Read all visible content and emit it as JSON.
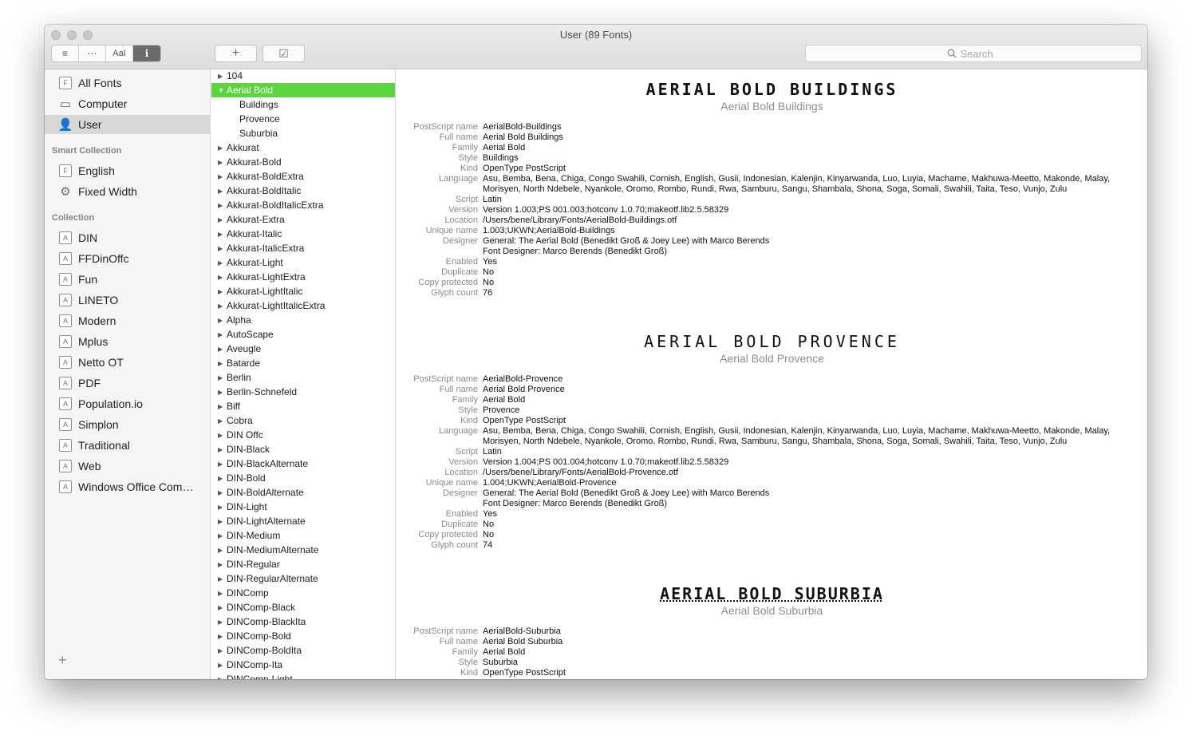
{
  "window": {
    "title": "User (89 Fonts)"
  },
  "toolbar": {
    "view_buttons": [
      "≡",
      "⋯",
      "AaI",
      "i"
    ],
    "add_label": "+",
    "validate_label": "☑",
    "search_placeholder": "Search"
  },
  "sidebar": {
    "libraries": [
      {
        "icon": "font-book-icon",
        "label": "All Fonts"
      },
      {
        "icon": "computer-icon",
        "label": "Computer"
      },
      {
        "icon": "user-icon",
        "label": "User"
      }
    ],
    "smart_heading": "Smart Collection",
    "smart": [
      {
        "icon": "font-book-icon",
        "label": "English"
      },
      {
        "icon": "gear-icon",
        "label": "Fixed Width"
      }
    ],
    "collection_heading": "Collection",
    "collections": [
      "DIN",
      "FFDinOffc",
      "Fun",
      "LINETO",
      "Modern",
      "Mplus",
      "Netto OT",
      "PDF",
      "Population.io",
      "Simplon",
      "Traditional",
      "Web",
      "Windows Office Comp…"
    ],
    "add_label": "+"
  },
  "fontlist": {
    "rows": [
      {
        "label": "104",
        "type": "collapsed"
      },
      {
        "label": "Aerial Bold",
        "type": "expanded"
      },
      {
        "label": "Buildings",
        "type": "child"
      },
      {
        "label": "Provence",
        "type": "child"
      },
      {
        "label": "Suburbia",
        "type": "child"
      },
      {
        "label": "Akkurat",
        "type": "collapsed"
      },
      {
        "label": "Akkurat-Bold",
        "type": "collapsed"
      },
      {
        "label": "Akkurat-BoldExtra",
        "type": "collapsed"
      },
      {
        "label": "Akkurat-BoldItalic",
        "type": "collapsed"
      },
      {
        "label": "Akkurat-BoldItalicExtra",
        "type": "collapsed"
      },
      {
        "label": "Akkurat-Extra",
        "type": "collapsed"
      },
      {
        "label": "Akkurat-Italic",
        "type": "collapsed"
      },
      {
        "label": "Akkurat-ItalicExtra",
        "type": "collapsed"
      },
      {
        "label": "Akkurat-Light",
        "type": "collapsed"
      },
      {
        "label": "Akkurat-LightExtra",
        "type": "collapsed"
      },
      {
        "label": "Akkurat-LightItalic",
        "type": "collapsed"
      },
      {
        "label": "Akkurat-LightItalicExtra",
        "type": "collapsed"
      },
      {
        "label": "Alpha",
        "type": "collapsed"
      },
      {
        "label": "AutoScape",
        "type": "collapsed"
      },
      {
        "label": "Aveugle",
        "type": "collapsed"
      },
      {
        "label": "Batarde",
        "type": "collapsed"
      },
      {
        "label": "Berlin",
        "type": "collapsed"
      },
      {
        "label": "Berlin-Schnefeld",
        "type": "collapsed"
      },
      {
        "label": "Biff",
        "type": "collapsed"
      },
      {
        "label": "Cobra",
        "type": "collapsed"
      },
      {
        "label": "DIN Offc",
        "type": "collapsed"
      },
      {
        "label": "DIN-Black",
        "type": "collapsed"
      },
      {
        "label": "DIN-BlackAlternate",
        "type": "collapsed"
      },
      {
        "label": "DIN-Bold",
        "type": "collapsed"
      },
      {
        "label": "DIN-BoldAlternate",
        "type": "collapsed"
      },
      {
        "label": "DIN-Light",
        "type": "collapsed"
      },
      {
        "label": "DIN-LightAlternate",
        "type": "collapsed"
      },
      {
        "label": "DIN-Medium",
        "type": "collapsed"
      },
      {
        "label": "DIN-MediumAlternate",
        "type": "collapsed"
      },
      {
        "label": "DIN-Regular",
        "type": "collapsed"
      },
      {
        "label": "DIN-RegularAlternate",
        "type": "collapsed"
      },
      {
        "label": "DINComp",
        "type": "collapsed"
      },
      {
        "label": "DINComp-Black",
        "type": "collapsed"
      },
      {
        "label": "DINComp-BlackIta",
        "type": "collapsed"
      },
      {
        "label": "DINComp-Bold",
        "type": "collapsed"
      },
      {
        "label": "DINComp-BoldIta",
        "type": "collapsed"
      },
      {
        "label": "DINComp-Ita",
        "type": "collapsed"
      },
      {
        "label": "DINComp-Light",
        "type": "collapsed"
      }
    ],
    "selected_color": "#5bd43e"
  },
  "detail": {
    "fonts": [
      {
        "sample": "AERIAL BOLD BUILDINGS",
        "name": "Aerial Bold Buildings",
        "fields": [
          [
            "PostScript name",
            "AerialBold-Buildings"
          ],
          [
            "Full name",
            "Aerial Bold Buildings"
          ],
          [
            "Family",
            "Aerial Bold"
          ],
          [
            "Style",
            "Buildings"
          ],
          [
            "Kind",
            "OpenType PostScript"
          ],
          [
            "Language",
            "Asu, Bemba, Bena, Chiga, Congo Swahili, Cornish, English, Gusii, Indonesian, Kalenjin, Kinyarwanda, Luo, Luyia, Machame, Makhuwa-Meetto, Makonde, Malay, Morisyen, North Ndebele, Nyankole, Oromo, Rombo, Rundi, Rwa, Samburu, Sangu, Shambala, Shona, Soga, Somali, Swahili, Taita, Teso, Vunjo, Zulu"
          ],
          [
            "Script",
            "Latin"
          ],
          [
            "Version",
            "Version 1.003;PS 001.003;hotconv 1.0.70;makeotf.lib2.5.58329"
          ],
          [
            "Location",
            "/Users/bene/Library/Fonts/AerialBold-Buildings.otf"
          ],
          [
            "Unique name",
            "1.003;UKWN;AerialBold-Buildings"
          ],
          [
            "Designer",
            "General: The Aerial Bold (Benedikt Groß & Joey Lee) with Marco Berends"
          ],
          [
            "",
            "Font Designer: Marco Berends (Benedikt Groß)"
          ],
          [
            "Enabled",
            "Yes"
          ],
          [
            "Duplicate",
            "No"
          ],
          [
            "Copy protected",
            "No"
          ],
          [
            "Glyph count",
            "76"
          ]
        ]
      },
      {
        "sample": "AERIAL BOLD PROVENCE",
        "name": "Aerial Bold Provence",
        "fields": [
          [
            "PostScript name",
            "AerialBold-Provence"
          ],
          [
            "Full name",
            "Aerial Bold Provence"
          ],
          [
            "Family",
            "Aerial Bold"
          ],
          [
            "Style",
            "Provence"
          ],
          [
            "Kind",
            "OpenType PostScript"
          ],
          [
            "Language",
            "Asu, Bemba, Bena, Chiga, Congo Swahili, Cornish, English, Gusii, Indonesian, Kalenjin, Kinyarwanda, Luo, Luyia, Machame, Makhuwa-Meetto, Makonde, Malay, Morisyen, North Ndebele, Nyankole, Oromo, Rombo, Rundi, Rwa, Samburu, Sangu, Shambala, Shona, Soga, Somali, Swahili, Taita, Teso, Vunjo, Zulu"
          ],
          [
            "Script",
            "Latin"
          ],
          [
            "Version",
            "Version 1.004;PS 001.004;hotconv 1.0.70;makeotf.lib2.5.58329"
          ],
          [
            "Location",
            "/Users/bene/Library/Fonts/AerialBold-Provence.otf"
          ],
          [
            "Unique name",
            "1.004;UKWN;AerialBold-Provence"
          ],
          [
            "Designer",
            "General: The Aerial Bold (Benedikt Groß & Joey Lee) with Marco Berends"
          ],
          [
            "",
            "Font Designer: Marco Berends (Benedikt Groß)"
          ],
          [
            "Enabled",
            "Yes"
          ],
          [
            "Duplicate",
            "No"
          ],
          [
            "Copy protected",
            "No"
          ],
          [
            "Glyph count",
            "74"
          ]
        ]
      },
      {
        "sample": "AERIAL BOLD SUBURBIA",
        "name": "Aerial Bold Suburbia",
        "fields": [
          [
            "PostScript name",
            "AerialBold-Suburbia"
          ],
          [
            "Full name",
            "Aerial Bold Suburbia"
          ],
          [
            "Family",
            "Aerial Bold"
          ],
          [
            "Style",
            "Suburbia"
          ],
          [
            "Kind",
            "OpenType PostScript"
          ]
        ]
      }
    ]
  }
}
